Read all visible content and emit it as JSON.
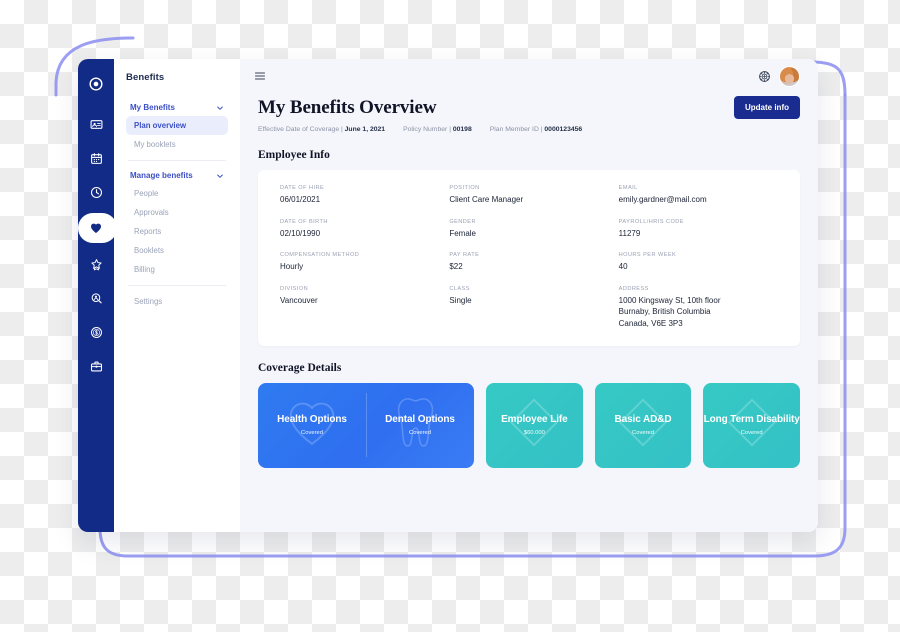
{
  "window": {
    "nav": {
      "title": "Benefits",
      "groups": [
        {
          "label": "My Benefits",
          "icon": "chevron-down-icon",
          "items": [
            {
              "label": "Plan overview",
              "selected": true
            },
            {
              "label": "My booklets",
              "selected": false
            }
          ]
        },
        {
          "label": "Manage benefits",
          "icon": "chevron-down-icon",
          "items": [
            {
              "label": "People",
              "selected": false
            },
            {
              "label": "Approvals",
              "selected": false
            },
            {
              "label": "Reports",
              "selected": false
            },
            {
              "label": "Booklets",
              "selected": false
            },
            {
              "label": "Billing",
              "selected": false
            }
          ]
        }
      ],
      "footer_items": [
        {
          "label": "Settings",
          "selected": false
        }
      ]
    },
    "rail": {
      "icons": [
        "logo-circle-icon",
        "id-card-icon",
        "calendar-icon",
        "clock-icon",
        "heart-icon",
        "badge-star-icon",
        "user-search-icon",
        "dollar-circle-icon",
        "briefcase-icon"
      ],
      "active_icon": "heart-icon"
    },
    "topbar": {
      "menu_icon": "hamburger-menu-icon",
      "settings_icon": "gear-icon",
      "avatar_icon": "user-avatar"
    },
    "header": {
      "title": "My Benefits  Overview",
      "update_button": "Update info",
      "meta": [
        {
          "label": "Effective Date of Coverage",
          "sep": "|",
          "value": "June 1, 2021"
        },
        {
          "label": "Policy Number",
          "sep": "|",
          "value": "00198"
        },
        {
          "label": "Plan Member ID",
          "sep": "|",
          "value": "0000123456"
        }
      ]
    },
    "employee_info": {
      "section_title": "Employee Info",
      "fields": [
        {
          "label": "DATE OF HIRE",
          "value": "06/01/2021"
        },
        {
          "label": "POSITION",
          "value": "Client Care Manager"
        },
        {
          "label": "EMAIL",
          "value": "emily.gardner@mail.com"
        },
        {
          "label": "DATE OF BIRTH",
          "value": "02/10/1990"
        },
        {
          "label": "GENDER",
          "value": "Female"
        },
        {
          "label": "PAYROLL/HRIS CODE",
          "value": "11279"
        },
        {
          "label": "COMPENSATION METHOD",
          "value": "Hourly"
        },
        {
          "label": "PAY RATE",
          "value": "$22"
        },
        {
          "label": "HOURS PER WEEK",
          "value": "40"
        },
        {
          "label": "DIVISION",
          "value": "Vancouver"
        },
        {
          "label": "CLASS",
          "value": "Single"
        },
        {
          "label": "ADDRESS",
          "value": "1000 Kingsway St, 10th floor\nBurnaby, British Columbia\nCanada, V6E 3P3"
        }
      ]
    },
    "coverage": {
      "section_title": "Coverage Details",
      "cards": [
        {
          "label": "Health Options",
          "sub": "Covered",
          "watermark": "heart-outline-icon",
          "color": "#2f6ff0"
        },
        {
          "label": "Dental Options",
          "sub": "Covered",
          "watermark": "tooth-outline-icon",
          "color": "#2f6ff0"
        },
        {
          "label": "Employee Life",
          "sub": "$60.000",
          "watermark": "diamond-outline-icon",
          "color": "#35c5c5"
        },
        {
          "label": "Basic AD&D",
          "sub": "Covered",
          "watermark": "diamond-outline-icon",
          "color": "#35c5c5"
        },
        {
          "label": "Long Term Disability",
          "sub": "Covered",
          "watermark": "diamond-outline-icon",
          "color": "#35c5c5"
        }
      ]
    }
  },
  "decoration": {
    "outline_color": "#8a8df0"
  }
}
